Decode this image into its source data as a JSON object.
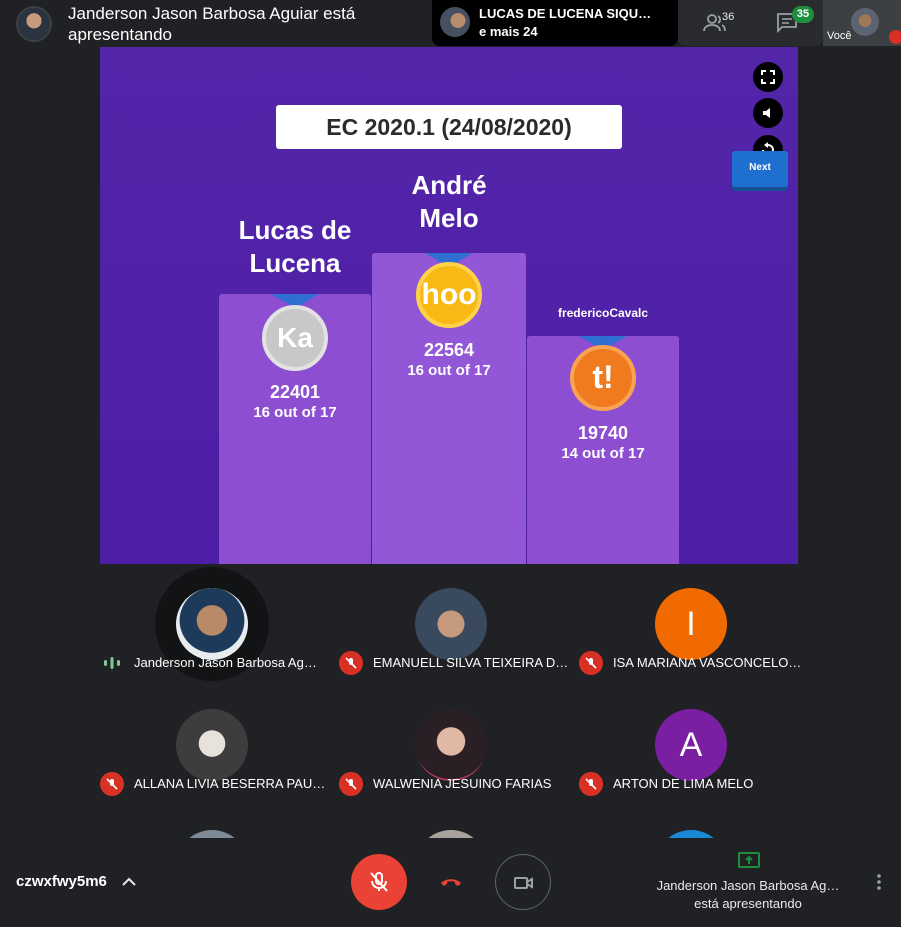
{
  "header": {
    "presenter_title": "Janderson Jason Barbosa Aguiar está apresentando",
    "pinned_name": "LUCAS DE LUCENA SIQU…",
    "pinned_more": "e mais 24",
    "people_count": "36",
    "chat_count": "35",
    "self_label": "Você"
  },
  "slide": {
    "title": "EC 2020.1 (24/08/2020)",
    "next_label": "Next",
    "podium": [
      {
        "name_line1": "Lucas de",
        "name_line2": "Lucena",
        "medal_text": "Ka",
        "score": "22401",
        "out_of": "16 out of 17"
      },
      {
        "name_line1": "André",
        "name_line2": "Melo",
        "medal_text": "hoo",
        "score": "22564",
        "out_of": "16 out of 17"
      },
      {
        "name": "fredericoCavalc",
        "medal_text": "t!",
        "score": "19740",
        "out_of": "14 out of 17"
      }
    ]
  },
  "participants": [
    {
      "name": "Janderson Jason Barbosa Ag…",
      "status": "speaking"
    },
    {
      "name": "EMANUELL SILVA TEIXEIRA D…",
      "status": "muted"
    },
    {
      "name": "ISA MARIANA VASCONCELO…",
      "status": "muted",
      "initial": "I"
    },
    {
      "name": "ALLANA LIVIA BESERRA PAU…",
      "status": "muted"
    },
    {
      "name": "WALWENIA JESUINO FARIAS",
      "status": "muted"
    },
    {
      "name": "ARTON DE LIMA MELO",
      "status": "muted",
      "initial": "A"
    }
  ],
  "footer": {
    "meeting_code": "czwxfwy5m6",
    "presenting_name": "Janderson Jason Barbosa Ag…",
    "presenting_sub": "está apresentando"
  },
  "colors": {
    "slide_bg": "#5325a9",
    "mic_off": "#d93025",
    "badge": "#1e8e3e",
    "avatar_isa": "#f06a00",
    "avatar_arton": "#7b1fa2"
  }
}
